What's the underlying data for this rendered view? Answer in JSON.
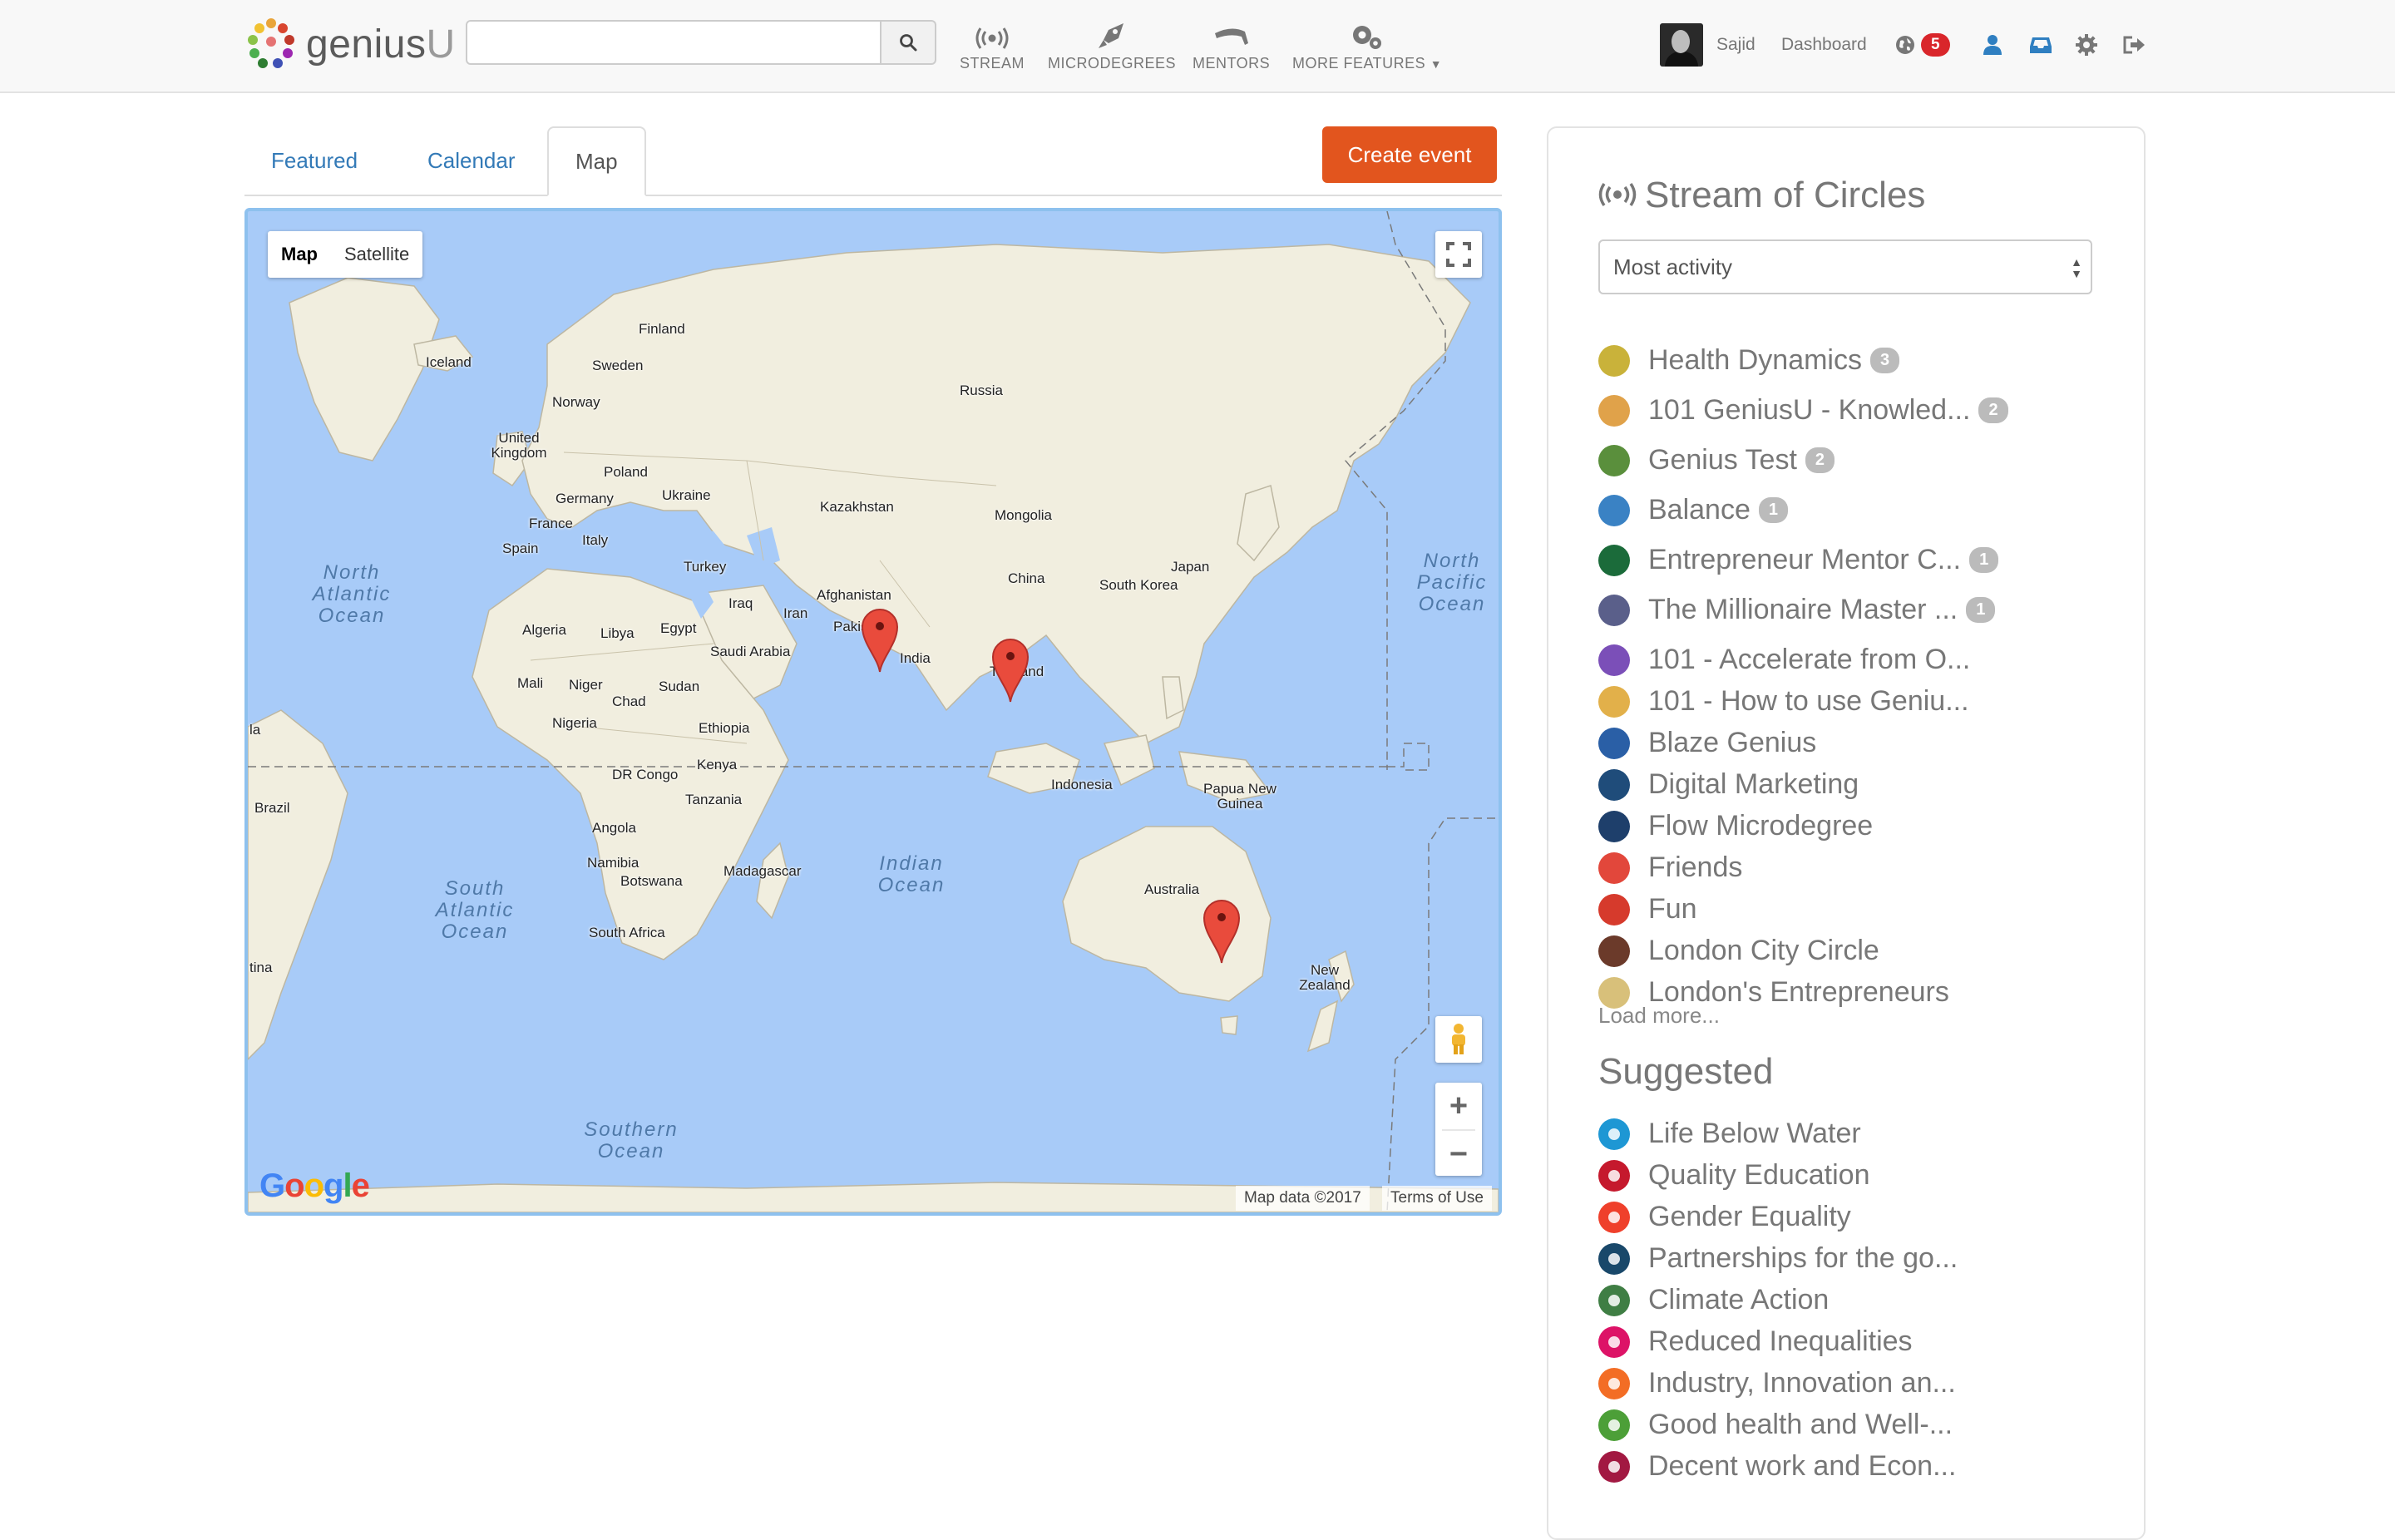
{
  "navbar": {
    "logo_genius": "genius",
    "logo_u": "U",
    "search_placeholder": "",
    "items": [
      {
        "label": "STREAM",
        "icon": "stream-icon"
      },
      {
        "label": "MICRODEGREES",
        "icon": "rocket-icon"
      },
      {
        "label": "MENTORS",
        "icon": "mentors-icon"
      },
      {
        "label": "MORE FEATURES",
        "icon": "gears-icon"
      }
    ],
    "user_name": "Sajid",
    "dashboard_label": "Dashboard",
    "notification_count": "5"
  },
  "tabs": [
    {
      "label": "Featured",
      "active": false
    },
    {
      "label": "Calendar",
      "active": false
    },
    {
      "label": "Map",
      "active": true
    }
  ],
  "create_event_label": "Create event",
  "map": {
    "type_map": "Map",
    "type_satellite": "Satellite",
    "attribution": "Map data ©2017",
    "terms": "Terms of Use",
    "google": "Google",
    "countries": [
      "Finland",
      "Iceland",
      "Sweden",
      "Norway",
      "Russia",
      "United Kingdom",
      "Poland",
      "Germany",
      "Ukraine",
      "Kazakhstan",
      "France",
      "Italy",
      "Spain",
      "Mongolia",
      "Turkey",
      "China",
      "Japan",
      "South Korea",
      "Afghanistan",
      "Iraq",
      "Iran",
      "Pakistan",
      "India",
      "Thailand",
      "Algeria",
      "Libya",
      "Egypt",
      "Saudi Arabia",
      "Mali",
      "Niger",
      "Sudan",
      "Chad",
      "Nigeria",
      "Ethiopia",
      "Kenya",
      "DR Congo",
      "Tanzania",
      "Angola",
      "Namibia",
      "Botswana",
      "South Africa",
      "Madagascar",
      "Indonesia",
      "Papua New Guinea",
      "Australia",
      "New Zealand",
      "Brazil",
      "tina",
      "la"
    ],
    "oceans": [
      "North Atlantic Ocean",
      "North Pacific Ocean",
      "South Atlantic Ocean",
      "Indian Ocean",
      "Southern Ocean"
    ],
    "markers": [
      "Pakistan/India",
      "Thailand",
      "Australia"
    ]
  },
  "sidebar": {
    "title": "Stream of Circles",
    "sort_value": "Most activity",
    "circles": [
      {
        "name": "Health Dynamics",
        "count": "3",
        "color": "#c9b23a"
      },
      {
        "name": "101 GeniusU - Knowled...",
        "count": "2",
        "color": "#e0a24a"
      },
      {
        "name": "Genius Test",
        "count": "2",
        "color": "#5a8f3c"
      },
      {
        "name": "Balance",
        "count": "1",
        "color": "#3a82c4"
      },
      {
        "name": "Entrepreneur Mentor C...",
        "count": "1",
        "color": "#1b6b3a"
      },
      {
        "name": "The Millionaire Master ...",
        "count": "1",
        "color": "#5a5f8a"
      },
      {
        "name": "101 - Accelerate from O...",
        "count": "",
        "color": "#7b4fb8"
      },
      {
        "name": "101 - How to use Geniu...",
        "count": "",
        "color": "#e2b04a"
      },
      {
        "name": "Blaze Genius",
        "count": "",
        "color": "#2a5fa6"
      },
      {
        "name": "Digital Marketing",
        "count": "",
        "color": "#1f4c7a"
      },
      {
        "name": "Flow Microdegree",
        "count": "",
        "color": "#1e3f6b"
      },
      {
        "name": "Friends",
        "count": "",
        "color": "#e2473b"
      },
      {
        "name": "Fun",
        "count": "",
        "color": "#d63a2c"
      },
      {
        "name": "London City Circle",
        "count": "",
        "color": "#6b3a2a"
      },
      {
        "name": "London's Entrepreneurs",
        "count": "",
        "color": "#d8c07a"
      }
    ],
    "load_more": "Load more...",
    "suggested_title": "Suggested",
    "suggested": [
      {
        "name": "Life Below Water",
        "color": "#1e97d4"
      },
      {
        "name": "Quality Education",
        "color": "#c5192d"
      },
      {
        "name": "Gender Equality",
        "color": "#ef402b"
      },
      {
        "name": "Partnerships for the go...",
        "color": "#19486a"
      },
      {
        "name": "Climate Action",
        "color": "#3f7e44"
      },
      {
        "name": "Reduced Inequalities",
        "color": "#dd1367"
      },
      {
        "name": "Industry, Innovation an...",
        "color": "#f36d25"
      },
      {
        "name": "Good health and Well-...",
        "color": "#4c9f38"
      },
      {
        "name": "Decent work and Econ...",
        "color": "#a21942"
      }
    ]
  }
}
